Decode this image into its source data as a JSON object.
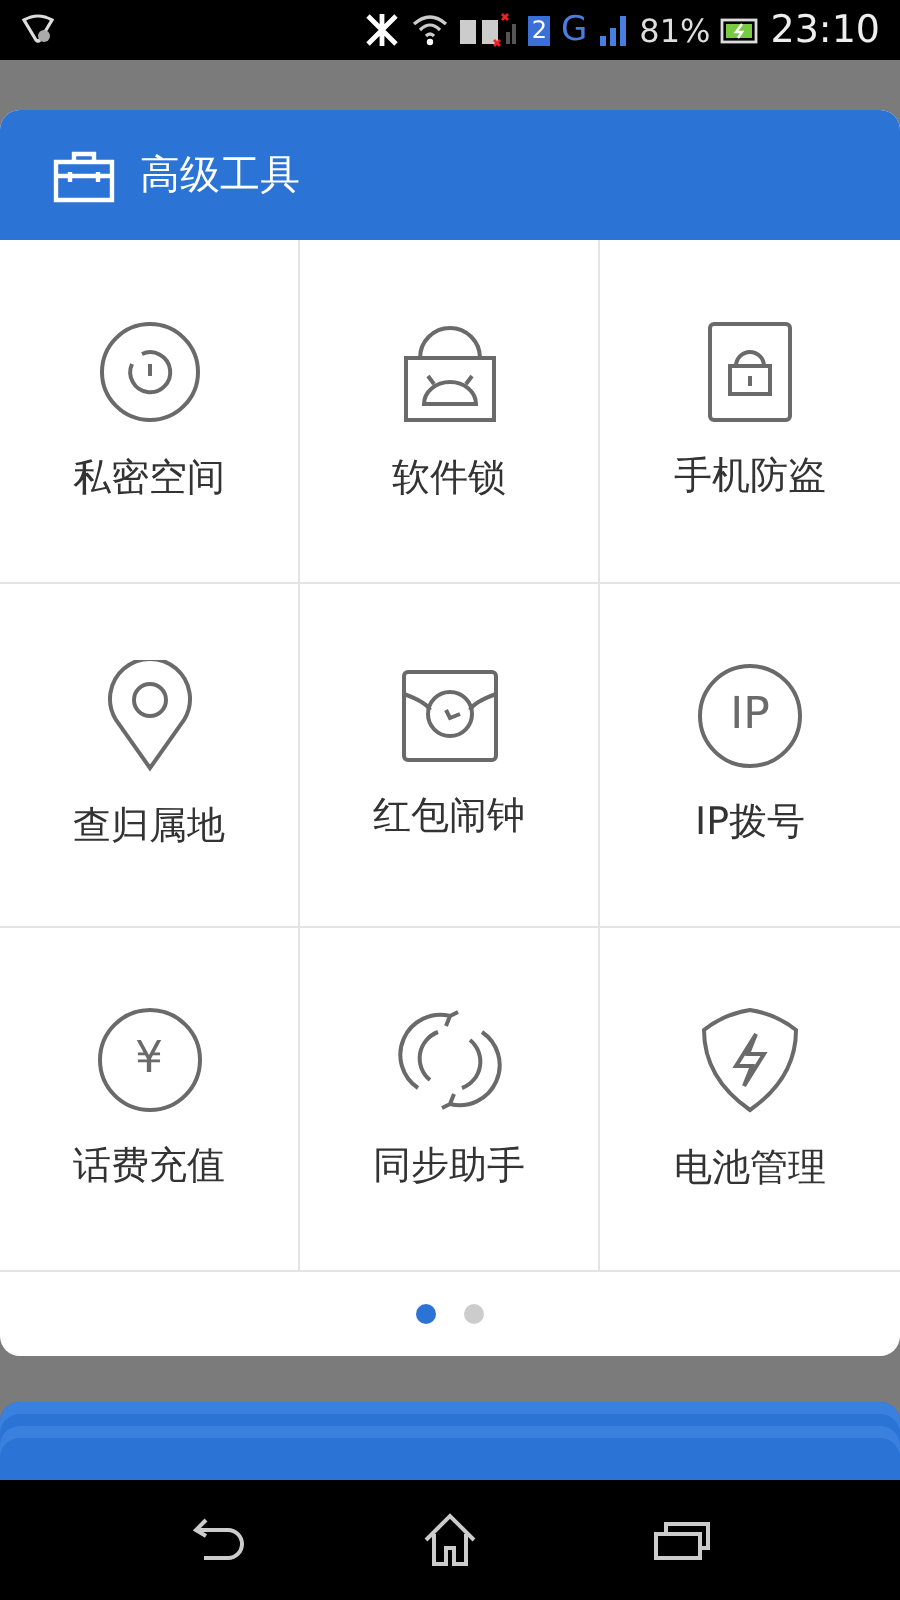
{
  "status_bar": {
    "sim_slot": "2",
    "network": "G",
    "battery": "81%",
    "time": "23:10"
  },
  "panel": {
    "title": "高级工具",
    "tools": [
      {
        "label": "私密空间",
        "kind": "vault"
      },
      {
        "label": "软件锁",
        "kind": "applock"
      },
      {
        "label": "手机防盗",
        "kind": "antitheft"
      },
      {
        "label": "查归属地",
        "kind": "location"
      },
      {
        "label": "红包闹钟",
        "kind": "envelope"
      },
      {
        "label": "IP拨号",
        "kind": "ip",
        "icon_text": "IP"
      },
      {
        "label": "话费充值",
        "kind": "yuan",
        "icon_text": "¥"
      },
      {
        "label": "同步助手",
        "kind": "sync"
      },
      {
        "label": "电池管理",
        "kind": "battery"
      }
    ],
    "pages": [
      {
        "selected": true
      },
      {
        "selected": false
      }
    ]
  }
}
